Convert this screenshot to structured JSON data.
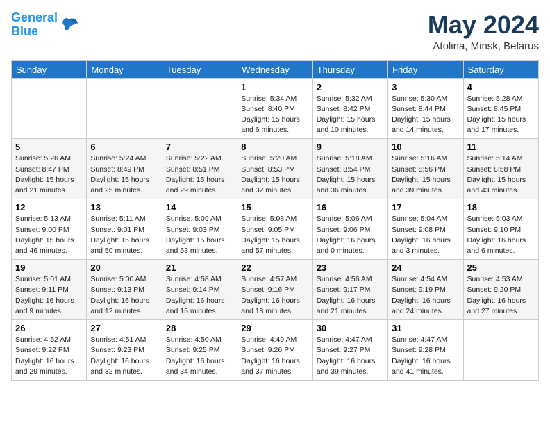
{
  "header": {
    "logo_line1": "General",
    "logo_line2": "Blue",
    "title": "May 2024",
    "location": "Atolina, Minsk, Belarus"
  },
  "weekdays": [
    "Sunday",
    "Monday",
    "Tuesday",
    "Wednesday",
    "Thursday",
    "Friday",
    "Saturday"
  ],
  "weeks": [
    [
      {
        "day": "",
        "info": ""
      },
      {
        "day": "",
        "info": ""
      },
      {
        "day": "",
        "info": ""
      },
      {
        "day": "1",
        "info": "Sunrise: 5:34 AM\nSunset: 8:40 PM\nDaylight: 15 hours\nand 6 minutes."
      },
      {
        "day": "2",
        "info": "Sunrise: 5:32 AM\nSunset: 8:42 PM\nDaylight: 15 hours\nand 10 minutes."
      },
      {
        "day": "3",
        "info": "Sunrise: 5:30 AM\nSunset: 8:44 PM\nDaylight: 15 hours\nand 14 minutes."
      },
      {
        "day": "4",
        "info": "Sunrise: 5:28 AM\nSunset: 8:45 PM\nDaylight: 15 hours\nand 17 minutes."
      }
    ],
    [
      {
        "day": "5",
        "info": "Sunrise: 5:26 AM\nSunset: 8:47 PM\nDaylight: 15 hours\nand 21 minutes."
      },
      {
        "day": "6",
        "info": "Sunrise: 5:24 AM\nSunset: 8:49 PM\nDaylight: 15 hours\nand 25 minutes."
      },
      {
        "day": "7",
        "info": "Sunrise: 5:22 AM\nSunset: 8:51 PM\nDaylight: 15 hours\nand 29 minutes."
      },
      {
        "day": "8",
        "info": "Sunrise: 5:20 AM\nSunset: 8:53 PM\nDaylight: 15 hours\nand 32 minutes."
      },
      {
        "day": "9",
        "info": "Sunrise: 5:18 AM\nSunset: 8:54 PM\nDaylight: 15 hours\nand 36 minutes."
      },
      {
        "day": "10",
        "info": "Sunrise: 5:16 AM\nSunset: 8:56 PM\nDaylight: 15 hours\nand 39 minutes."
      },
      {
        "day": "11",
        "info": "Sunrise: 5:14 AM\nSunset: 8:58 PM\nDaylight: 15 hours\nand 43 minutes."
      }
    ],
    [
      {
        "day": "12",
        "info": "Sunrise: 5:13 AM\nSunset: 9:00 PM\nDaylight: 15 hours\nand 46 minutes."
      },
      {
        "day": "13",
        "info": "Sunrise: 5:11 AM\nSunset: 9:01 PM\nDaylight: 15 hours\nand 50 minutes."
      },
      {
        "day": "14",
        "info": "Sunrise: 5:09 AM\nSunset: 9:03 PM\nDaylight: 15 hours\nand 53 minutes."
      },
      {
        "day": "15",
        "info": "Sunrise: 5:08 AM\nSunset: 9:05 PM\nDaylight: 15 hours\nand 57 minutes."
      },
      {
        "day": "16",
        "info": "Sunrise: 5:06 AM\nSunset: 9:06 PM\nDaylight: 16 hours\nand 0 minutes."
      },
      {
        "day": "17",
        "info": "Sunrise: 5:04 AM\nSunset: 9:08 PM\nDaylight: 16 hours\nand 3 minutes."
      },
      {
        "day": "18",
        "info": "Sunrise: 5:03 AM\nSunset: 9:10 PM\nDaylight: 16 hours\nand 6 minutes."
      }
    ],
    [
      {
        "day": "19",
        "info": "Sunrise: 5:01 AM\nSunset: 9:11 PM\nDaylight: 16 hours\nand 9 minutes."
      },
      {
        "day": "20",
        "info": "Sunrise: 5:00 AM\nSunset: 9:13 PM\nDaylight: 16 hours\nand 12 minutes."
      },
      {
        "day": "21",
        "info": "Sunrise: 4:58 AM\nSunset: 9:14 PM\nDaylight: 16 hours\nand 15 minutes."
      },
      {
        "day": "22",
        "info": "Sunrise: 4:57 AM\nSunset: 9:16 PM\nDaylight: 16 hours\nand 18 minutes."
      },
      {
        "day": "23",
        "info": "Sunrise: 4:56 AM\nSunset: 9:17 PM\nDaylight: 16 hours\nand 21 minutes."
      },
      {
        "day": "24",
        "info": "Sunrise: 4:54 AM\nSunset: 9:19 PM\nDaylight: 16 hours\nand 24 minutes."
      },
      {
        "day": "25",
        "info": "Sunrise: 4:53 AM\nSunset: 9:20 PM\nDaylight: 16 hours\nand 27 minutes."
      }
    ],
    [
      {
        "day": "26",
        "info": "Sunrise: 4:52 AM\nSunset: 9:22 PM\nDaylight: 16 hours\nand 29 minutes."
      },
      {
        "day": "27",
        "info": "Sunrise: 4:51 AM\nSunset: 9:23 PM\nDaylight: 16 hours\nand 32 minutes."
      },
      {
        "day": "28",
        "info": "Sunrise: 4:50 AM\nSunset: 9:25 PM\nDaylight: 16 hours\nand 34 minutes."
      },
      {
        "day": "29",
        "info": "Sunrise: 4:49 AM\nSunset: 9:26 PM\nDaylight: 16 hours\nand 37 minutes."
      },
      {
        "day": "30",
        "info": "Sunrise: 4:47 AM\nSunset: 9:27 PM\nDaylight: 16 hours\nand 39 minutes."
      },
      {
        "day": "31",
        "info": "Sunrise: 4:47 AM\nSunset: 9:28 PM\nDaylight: 16 hours\nand 41 minutes."
      },
      {
        "day": "",
        "info": ""
      }
    ]
  ]
}
